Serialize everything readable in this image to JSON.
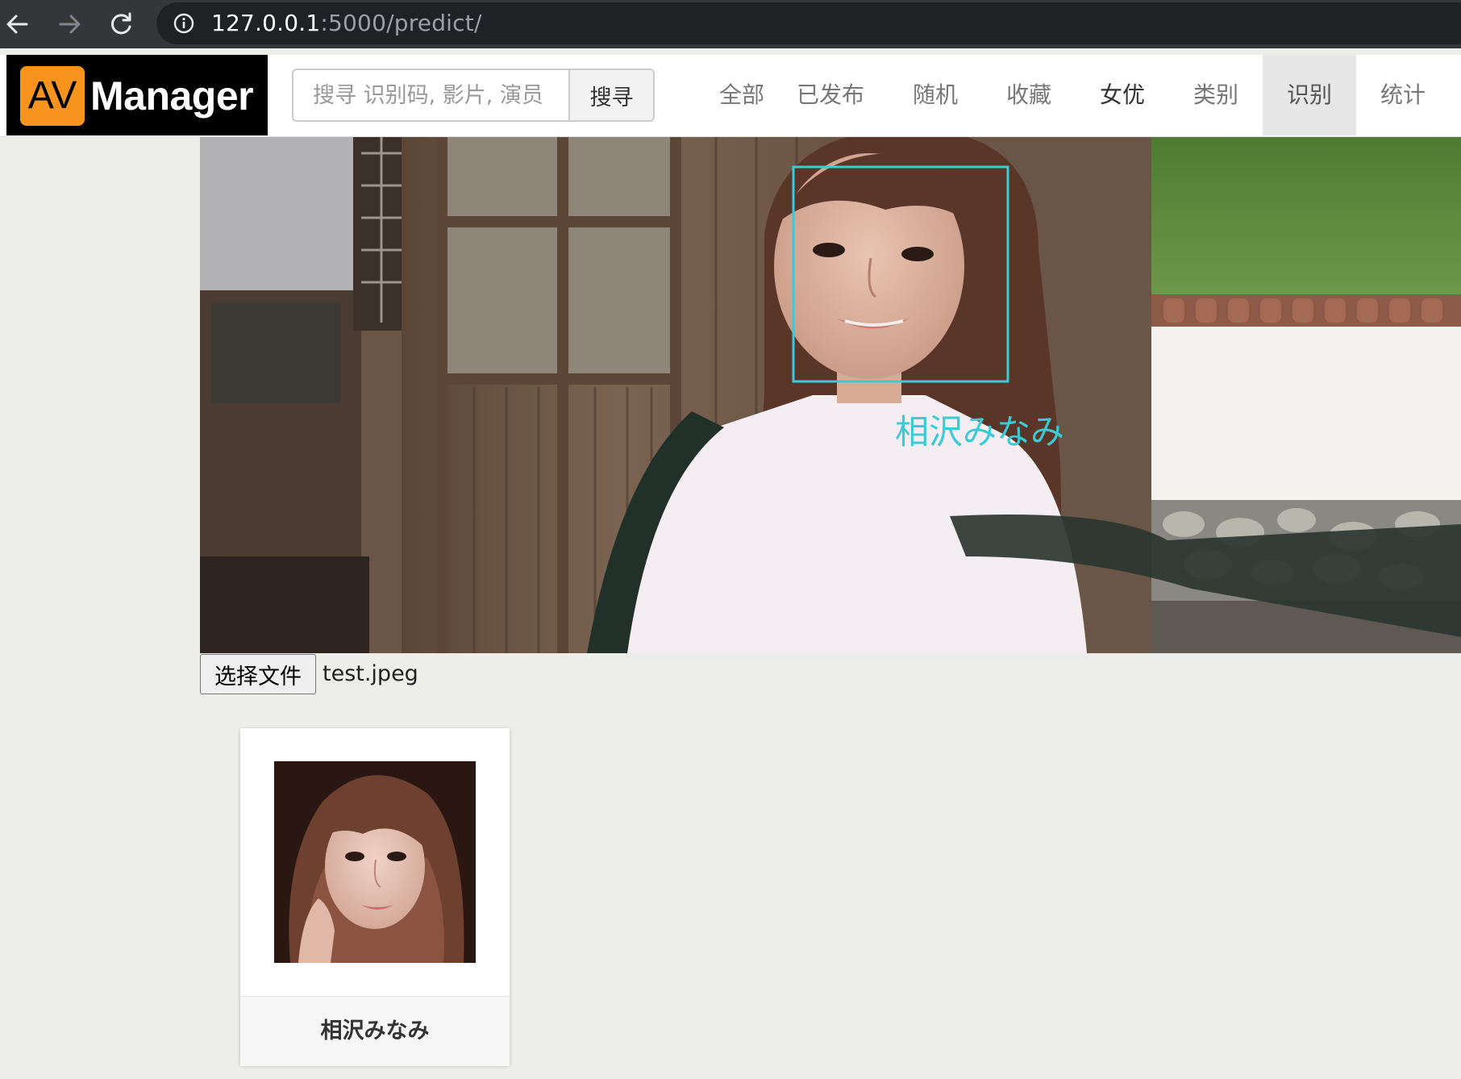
{
  "browser": {
    "url_host": "127.0.0.1",
    "url_rest": ":5000/predict/"
  },
  "brand": {
    "badge": "AV",
    "name": "Manager",
    "badge_color": "#f7941d"
  },
  "search": {
    "placeholder": "搜寻 识别码, 影片, 演员",
    "button_label": "搜寻"
  },
  "nav": {
    "items": [
      {
        "label": "全部"
      },
      {
        "label": "已发布"
      },
      {
        "label": "随机"
      },
      {
        "label": "收藏"
      },
      {
        "label": "女优"
      },
      {
        "label": "类别"
      },
      {
        "label": "识别",
        "active": true
      },
      {
        "label": "统计"
      }
    ]
  },
  "result": {
    "face_label": "相沢みなみ",
    "box_color": "#3ccbd6"
  },
  "upload": {
    "button_label": "选择文件",
    "file_name": "test.jpeg"
  },
  "match": {
    "name": "相沢みなみ"
  },
  "colors": {
    "page_bg": "#ededea",
    "browser_bar": "#35363a",
    "active_nav_bg": "#e7e7e7"
  }
}
